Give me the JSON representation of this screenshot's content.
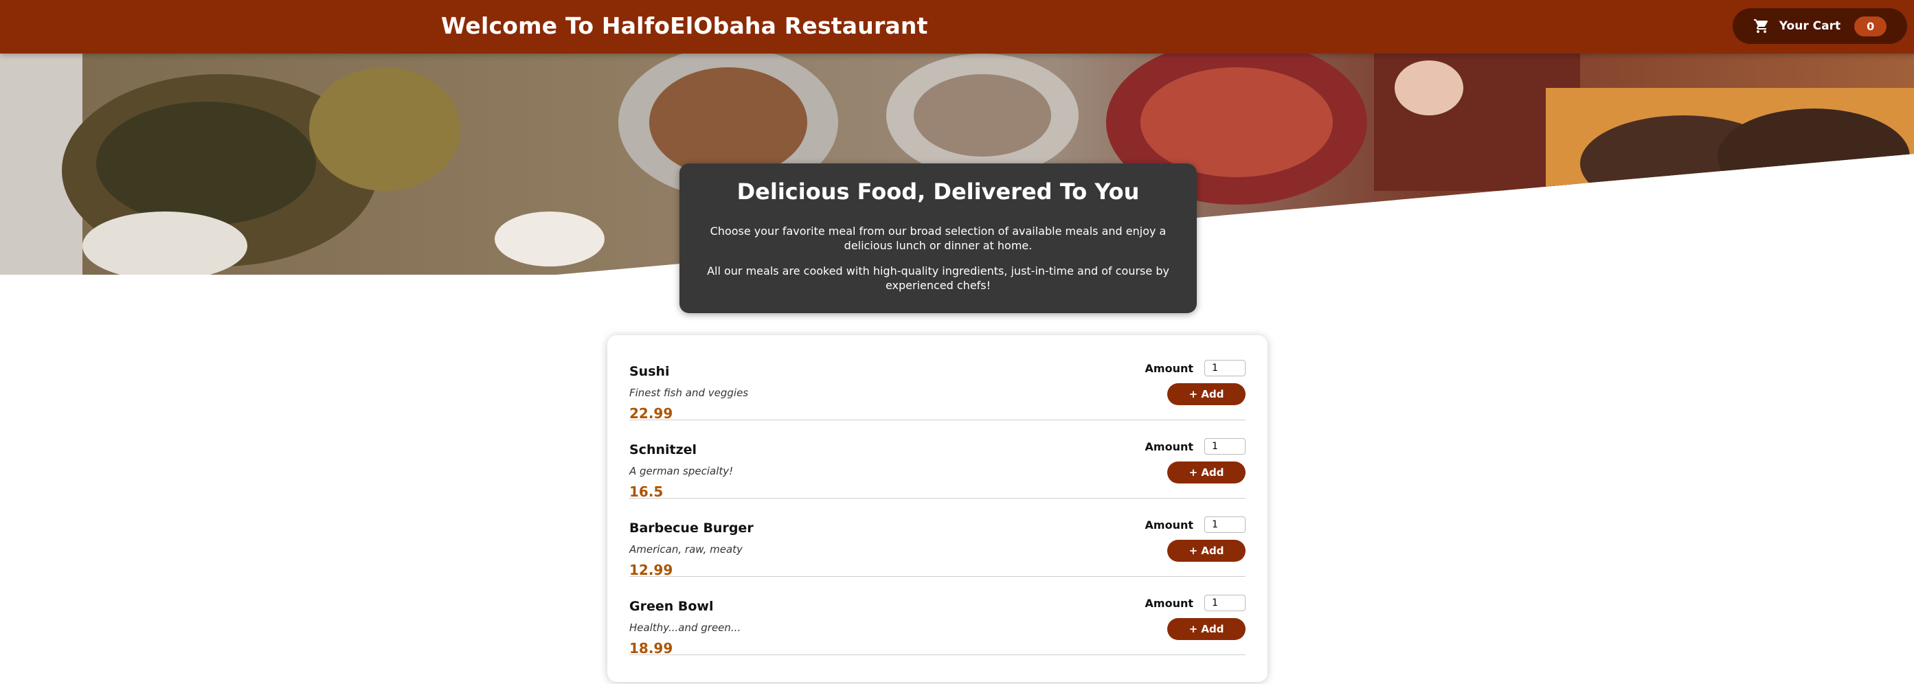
{
  "header": {
    "title": "Welcome To HalfoElObaha Restaurant",
    "cart_label": "Your Cart",
    "cart_count": "0"
  },
  "summary": {
    "title": "Delicious Food, Delivered To You",
    "paragraph1": "Choose your favorite meal from our broad selection of available meals and enjoy a delicious lunch or dinner at home.",
    "paragraph2": "All our meals are cooked with high-quality ingredients, just-in-time and of course by experienced chefs!"
  },
  "meals": [
    {
      "name": "Sushi",
      "description": "Finest fish and veggies",
      "price": "22.99",
      "amount_label": "Amount",
      "amount": "1",
      "add_label": "+ Add"
    },
    {
      "name": "Schnitzel",
      "description": "A german specialty!",
      "price": "16.5",
      "amount_label": "Amount",
      "amount": "1",
      "add_label": "+ Add"
    },
    {
      "name": "Barbecue Burger",
      "description": "American, raw, meaty",
      "price": "12.99",
      "amount_label": "Amount",
      "amount": "1",
      "add_label": "+ Add"
    },
    {
      "name": "Green Bowl",
      "description": "Healthy...and green...",
      "price": "18.99",
      "amount_label": "Amount",
      "amount": "1",
      "add_label": "+ Add"
    }
  ],
  "colors": {
    "header": "#8a2b06",
    "cart_button": "#4d1601",
    "badge": "#b94517",
    "summary_bg": "#383838",
    "price": "#ad5502"
  },
  "icons": {
    "cart": "cart-icon",
    "hero": "food-banquet-image"
  }
}
